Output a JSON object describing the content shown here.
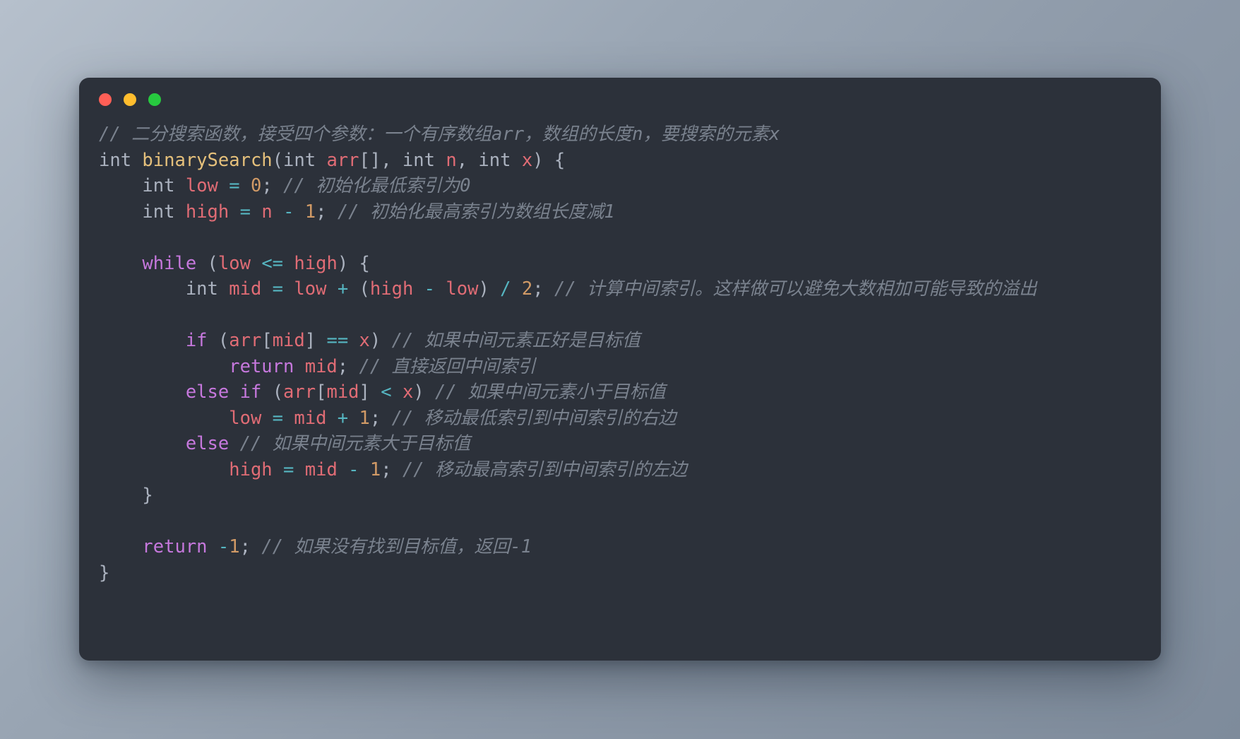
{
  "window": {
    "traffic_lights": [
      {
        "name": "close",
        "color": "#ff5f56"
      },
      {
        "name": "minimize",
        "color": "#ffbd2e"
      },
      {
        "name": "maximize",
        "color": "#27c93f"
      }
    ],
    "background_color": "#2c313a"
  },
  "theme": {
    "keyword": "#c678dd",
    "function": "#e5c07b",
    "type": "#abb2bf",
    "variable": "#e06c75",
    "operator": "#56b6c2",
    "number": "#d19a66",
    "comment": "#7a828e",
    "punctuation": "#abb2bf",
    "editor_background": "#2c313a",
    "page_background": "#8d99a8"
  },
  "code": {
    "language": "c",
    "plain_text": "// 二分搜索函数，接受四个参数：一个有序数组arr，数组的长度n，要搜索的元素x\nint binarySearch(int arr[], int n, int x) {\n    int low = 0; // 初始化最低索引为0\n    int high = n - 1; // 初始化最高索引为数组长度减1\n\n    while (low <= high) {\n        int mid = low + (high - low) / 2; // 计算中间索引。这样做可以避免大数相加可能导致的溢出\n\n        if (arr[mid] == x) // 如果中间元素正好是目标值\n            return mid; // 直接返回中间索引\n        else if (arr[mid] < x) // 如果中间元素小于目标值\n            low = mid + 1; // 移动最低索引到中间索引的右边\n        else // 如果中间元素大于目标值\n            high = mid - 1; // 移动最高索引到中间索引的左边\n    }\n\n    return -1; // 如果没有找到目标值，返回-1\n}",
    "lines": [
      [
        {
          "t": "comment",
          "v": "// 二分搜索函数，接受四个参数：一个有序数组arr，数组的长度n，要搜索的元素x"
        }
      ],
      [
        {
          "t": "type",
          "v": "int"
        },
        {
          "t": "plain",
          "v": " "
        },
        {
          "t": "function",
          "v": "binarySearch"
        },
        {
          "t": "punctuation",
          "v": "("
        },
        {
          "t": "type",
          "v": "int"
        },
        {
          "t": "plain",
          "v": " "
        },
        {
          "t": "variable",
          "v": "arr"
        },
        {
          "t": "punctuation",
          "v": "[], "
        },
        {
          "t": "type",
          "v": "int"
        },
        {
          "t": "plain",
          "v": " "
        },
        {
          "t": "variable",
          "v": "n"
        },
        {
          "t": "punctuation",
          "v": ", "
        },
        {
          "t": "type",
          "v": "int"
        },
        {
          "t": "plain",
          "v": " "
        },
        {
          "t": "variable",
          "v": "x"
        },
        {
          "t": "punctuation",
          "v": ") {"
        }
      ],
      [
        {
          "t": "plain",
          "v": "    "
        },
        {
          "t": "type",
          "v": "int"
        },
        {
          "t": "plain",
          "v": " "
        },
        {
          "t": "variable",
          "v": "low"
        },
        {
          "t": "plain",
          "v": " "
        },
        {
          "t": "operator",
          "v": "="
        },
        {
          "t": "plain",
          "v": " "
        },
        {
          "t": "number",
          "v": "0"
        },
        {
          "t": "punctuation",
          "v": ";"
        },
        {
          "t": "plain",
          "v": " "
        },
        {
          "t": "comment",
          "v": "// 初始化最低索引为0"
        }
      ],
      [
        {
          "t": "plain",
          "v": "    "
        },
        {
          "t": "type",
          "v": "int"
        },
        {
          "t": "plain",
          "v": " "
        },
        {
          "t": "variable",
          "v": "high"
        },
        {
          "t": "plain",
          "v": " "
        },
        {
          "t": "operator",
          "v": "="
        },
        {
          "t": "plain",
          "v": " "
        },
        {
          "t": "variable",
          "v": "n"
        },
        {
          "t": "plain",
          "v": " "
        },
        {
          "t": "operator",
          "v": "-"
        },
        {
          "t": "plain",
          "v": " "
        },
        {
          "t": "number",
          "v": "1"
        },
        {
          "t": "punctuation",
          "v": ";"
        },
        {
          "t": "plain",
          "v": " "
        },
        {
          "t": "comment",
          "v": "// 初始化最高索引为数组长度减1"
        }
      ],
      [],
      [
        {
          "t": "plain",
          "v": "    "
        },
        {
          "t": "keyword",
          "v": "while"
        },
        {
          "t": "plain",
          "v": " "
        },
        {
          "t": "punctuation",
          "v": "("
        },
        {
          "t": "variable",
          "v": "low"
        },
        {
          "t": "plain",
          "v": " "
        },
        {
          "t": "operator",
          "v": "<="
        },
        {
          "t": "plain",
          "v": " "
        },
        {
          "t": "variable",
          "v": "high"
        },
        {
          "t": "punctuation",
          "v": ") {"
        }
      ],
      [
        {
          "t": "plain",
          "v": "        "
        },
        {
          "t": "type",
          "v": "int"
        },
        {
          "t": "plain",
          "v": " "
        },
        {
          "t": "variable",
          "v": "mid"
        },
        {
          "t": "plain",
          "v": " "
        },
        {
          "t": "operator",
          "v": "="
        },
        {
          "t": "plain",
          "v": " "
        },
        {
          "t": "variable",
          "v": "low"
        },
        {
          "t": "plain",
          "v": " "
        },
        {
          "t": "operator",
          "v": "+"
        },
        {
          "t": "plain",
          "v": " "
        },
        {
          "t": "punctuation",
          "v": "("
        },
        {
          "t": "variable",
          "v": "high"
        },
        {
          "t": "plain",
          "v": " "
        },
        {
          "t": "operator",
          "v": "-"
        },
        {
          "t": "plain",
          "v": " "
        },
        {
          "t": "variable",
          "v": "low"
        },
        {
          "t": "punctuation",
          "v": ")"
        },
        {
          "t": "plain",
          "v": " "
        },
        {
          "t": "operator",
          "v": "/"
        },
        {
          "t": "plain",
          "v": " "
        },
        {
          "t": "number",
          "v": "2"
        },
        {
          "t": "punctuation",
          "v": ";"
        },
        {
          "t": "plain",
          "v": " "
        },
        {
          "t": "comment",
          "v": "// 计算中间索引。这样做可以避免大数相加可能导致的溢出"
        }
      ],
      [],
      [
        {
          "t": "plain",
          "v": "        "
        },
        {
          "t": "keyword",
          "v": "if"
        },
        {
          "t": "plain",
          "v": " "
        },
        {
          "t": "punctuation",
          "v": "("
        },
        {
          "t": "variable",
          "v": "arr"
        },
        {
          "t": "punctuation",
          "v": "["
        },
        {
          "t": "variable",
          "v": "mid"
        },
        {
          "t": "punctuation",
          "v": "]"
        },
        {
          "t": "plain",
          "v": " "
        },
        {
          "t": "operator",
          "v": "=="
        },
        {
          "t": "plain",
          "v": " "
        },
        {
          "t": "variable",
          "v": "x"
        },
        {
          "t": "punctuation",
          "v": ")"
        },
        {
          "t": "plain",
          "v": " "
        },
        {
          "t": "comment",
          "v": "// 如果中间元素正好是目标值"
        }
      ],
      [
        {
          "t": "plain",
          "v": "            "
        },
        {
          "t": "keyword",
          "v": "return"
        },
        {
          "t": "plain",
          "v": " "
        },
        {
          "t": "variable",
          "v": "mid"
        },
        {
          "t": "punctuation",
          "v": ";"
        },
        {
          "t": "plain",
          "v": " "
        },
        {
          "t": "comment",
          "v": "// 直接返回中间索引"
        }
      ],
      [
        {
          "t": "plain",
          "v": "        "
        },
        {
          "t": "keyword",
          "v": "else"
        },
        {
          "t": "plain",
          "v": " "
        },
        {
          "t": "keyword",
          "v": "if"
        },
        {
          "t": "plain",
          "v": " "
        },
        {
          "t": "punctuation",
          "v": "("
        },
        {
          "t": "variable",
          "v": "arr"
        },
        {
          "t": "punctuation",
          "v": "["
        },
        {
          "t": "variable",
          "v": "mid"
        },
        {
          "t": "punctuation",
          "v": "]"
        },
        {
          "t": "plain",
          "v": " "
        },
        {
          "t": "operator",
          "v": "<"
        },
        {
          "t": "plain",
          "v": " "
        },
        {
          "t": "variable",
          "v": "x"
        },
        {
          "t": "punctuation",
          "v": ")"
        },
        {
          "t": "plain",
          "v": " "
        },
        {
          "t": "comment",
          "v": "// 如果中间元素小于目标值"
        }
      ],
      [
        {
          "t": "plain",
          "v": "            "
        },
        {
          "t": "variable",
          "v": "low"
        },
        {
          "t": "plain",
          "v": " "
        },
        {
          "t": "operator",
          "v": "="
        },
        {
          "t": "plain",
          "v": " "
        },
        {
          "t": "variable",
          "v": "mid"
        },
        {
          "t": "plain",
          "v": " "
        },
        {
          "t": "operator",
          "v": "+"
        },
        {
          "t": "plain",
          "v": " "
        },
        {
          "t": "number",
          "v": "1"
        },
        {
          "t": "punctuation",
          "v": ";"
        },
        {
          "t": "plain",
          "v": " "
        },
        {
          "t": "comment",
          "v": "// 移动最低索引到中间索引的右边"
        }
      ],
      [
        {
          "t": "plain",
          "v": "        "
        },
        {
          "t": "keyword",
          "v": "else"
        },
        {
          "t": "plain",
          "v": " "
        },
        {
          "t": "comment",
          "v": "// 如果中间元素大于目标值"
        }
      ],
      [
        {
          "t": "plain",
          "v": "            "
        },
        {
          "t": "variable",
          "v": "high"
        },
        {
          "t": "plain",
          "v": " "
        },
        {
          "t": "operator",
          "v": "="
        },
        {
          "t": "plain",
          "v": " "
        },
        {
          "t": "variable",
          "v": "mid"
        },
        {
          "t": "plain",
          "v": " "
        },
        {
          "t": "operator",
          "v": "-"
        },
        {
          "t": "plain",
          "v": " "
        },
        {
          "t": "number",
          "v": "1"
        },
        {
          "t": "punctuation",
          "v": ";"
        },
        {
          "t": "plain",
          "v": " "
        },
        {
          "t": "comment",
          "v": "// 移动最高索引到中间索引的左边"
        }
      ],
      [
        {
          "t": "plain",
          "v": "    "
        },
        {
          "t": "punctuation",
          "v": "}"
        }
      ],
      [],
      [
        {
          "t": "plain",
          "v": "    "
        },
        {
          "t": "keyword",
          "v": "return"
        },
        {
          "t": "plain",
          "v": " "
        },
        {
          "t": "operator",
          "v": "-"
        },
        {
          "t": "number",
          "v": "1"
        },
        {
          "t": "punctuation",
          "v": ";"
        },
        {
          "t": "plain",
          "v": " "
        },
        {
          "t": "comment",
          "v": "// 如果没有找到目标值，返回-1"
        }
      ],
      [
        {
          "t": "punctuation",
          "v": "}"
        }
      ]
    ]
  }
}
